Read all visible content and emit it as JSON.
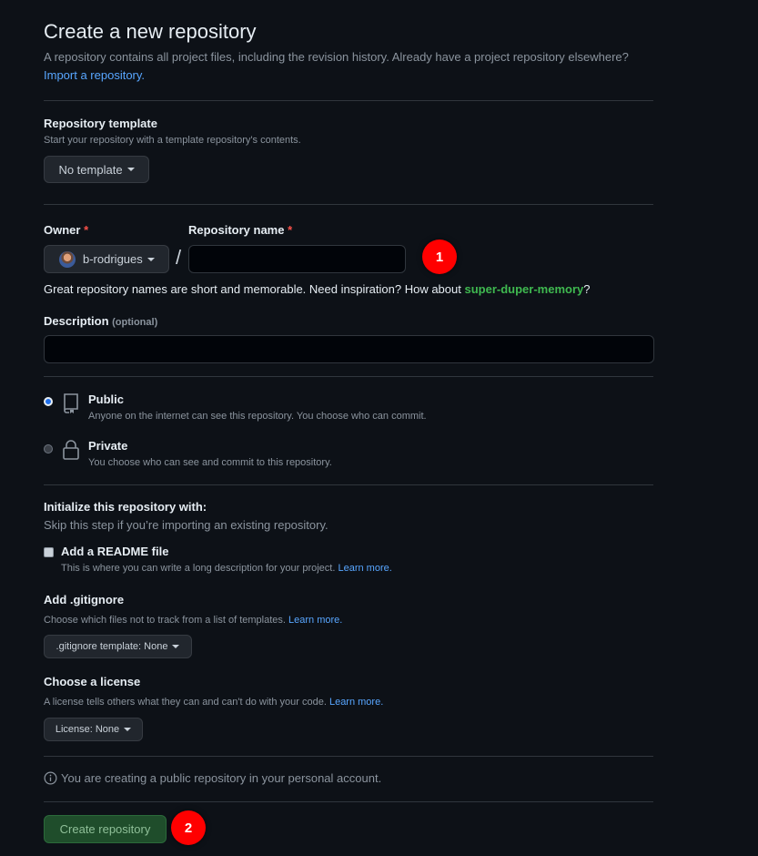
{
  "page": {
    "title": "Create a new repository",
    "subtitle": "A repository contains all project files, including the revision history. Already have a project repository elsewhere?",
    "import_link": "Import a repository."
  },
  "template": {
    "label": "Repository template",
    "hint": "Start your repository with a template repository's contents.",
    "button": "No template"
  },
  "owner": {
    "label": "Owner",
    "required": "*",
    "value": "b-rodrigues"
  },
  "repo_name": {
    "label": "Repository name",
    "required": "*",
    "value": "",
    "separator": "/"
  },
  "suggestion": {
    "text": "Great repository names are short and memorable. Need inspiration? How about",
    "name": "super-duper-memory",
    "end": "?"
  },
  "description": {
    "label": "Description",
    "optional": "(optional)",
    "value": ""
  },
  "visibility": {
    "public": {
      "title": "Public",
      "desc": "Anyone on the internet can see this repository. You choose who can commit."
    },
    "private": {
      "title": "Private",
      "desc": "You choose who can see and commit to this repository."
    },
    "selected": "public"
  },
  "init": {
    "title": "Initialize this repository with:",
    "hint": "Skip this step if you’re importing an existing repository.",
    "readme": {
      "label": "Add a README file",
      "desc": "This is where you can write a long description for your project.",
      "learn": "Learn more."
    }
  },
  "gitignore": {
    "label": "Add .gitignore",
    "desc": "Choose which files not to track from a list of templates.",
    "learn": "Learn more.",
    "button": ".gitignore template: None"
  },
  "license": {
    "label": "Choose a license",
    "desc": "A license tells others what they can and can't do with your code.",
    "learn": "Learn more.",
    "button": "License: None"
  },
  "notice": "You are creating a public repository in your personal account.",
  "submit": "Create repository",
  "markers": {
    "one": "1",
    "two": "2"
  },
  "colors": {
    "background": "#0d1117",
    "accent_link": "#58a6ff",
    "suggest": "#3fb950",
    "submit_bg": "#238636",
    "marker": "#ff0000"
  }
}
